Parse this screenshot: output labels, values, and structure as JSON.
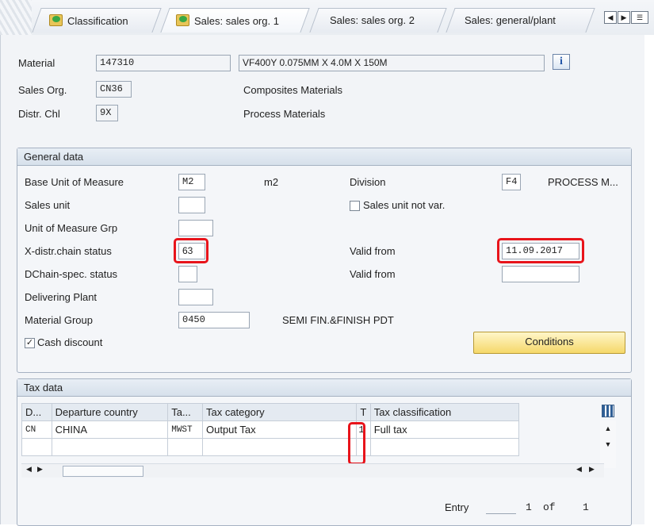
{
  "tabs": [
    {
      "label": "Classification",
      "active": false,
      "has_icon": true
    },
    {
      "label": "Sales: sales org. 1",
      "active": true,
      "has_icon": true
    },
    {
      "label": "Sales: sales org. 2",
      "active": false,
      "has_icon": false
    },
    {
      "label": "Sales: general/plant",
      "active": false,
      "has_icon": false
    }
  ],
  "header": {
    "material_label": "Material",
    "material_value": "147310",
    "material_desc": "VF400Y 0.075MM X 4.0M X 150M",
    "sales_org_label": "Sales Org.",
    "sales_org_value": "CN36",
    "sales_org_desc": "Composites Materials",
    "distr_chl_label": "Distr. Chl",
    "distr_chl_value": "9X",
    "distr_chl_desc": "Process Materials",
    "info_icon": "info-icon"
  },
  "general": {
    "title": "General data",
    "base_uom_label": "Base Unit of Measure",
    "base_uom_value": "M2",
    "base_uom_text": "m2",
    "division_label": "Division",
    "division_value": "F4",
    "division_text": "PROCESS M...",
    "sales_unit_label": "Sales unit",
    "sales_unit_value": "",
    "sales_unit_not_var_label": "Sales unit not var.",
    "uom_grp_label": "Unit of Measure Grp",
    "uom_grp_value": "",
    "xdistr_label": "X-distr.chain status",
    "xdistr_value": "63",
    "valid_from_label": "Valid from",
    "valid_from_value": "11.09.2017",
    "dchain_label": "DChain-spec. status",
    "dchain_value": "",
    "valid_from2_label": "Valid from",
    "valid_from2_value": "",
    "delivering_plant_label": "Delivering Plant",
    "delivering_plant_value": "",
    "material_group_label": "Material Group",
    "material_group_value": "0450",
    "material_group_text": "SEMI FIN.&FINISH PDT",
    "cash_discount_label": "Cash discount",
    "cash_discount_checked": true,
    "conditions_label": "Conditions"
  },
  "tax": {
    "title": "Tax data",
    "columns": [
      "D...",
      "Departure country",
      "Ta...",
      "Tax category",
      "T",
      "Tax classification"
    ],
    "rows": [
      [
        "CN",
        "CHINA",
        "MWST",
        "Output Tax",
        "1",
        "Full tax"
      ],
      [
        "",
        "",
        "",
        "",
        "",
        ""
      ]
    ],
    "entry_label": "Entry",
    "entry_current": "1",
    "entry_of": "of",
    "entry_total": "1"
  },
  "colors": {
    "highlight": "#e8141b",
    "button": "#f5d86a",
    "group_header": "#d6e0eb"
  }
}
